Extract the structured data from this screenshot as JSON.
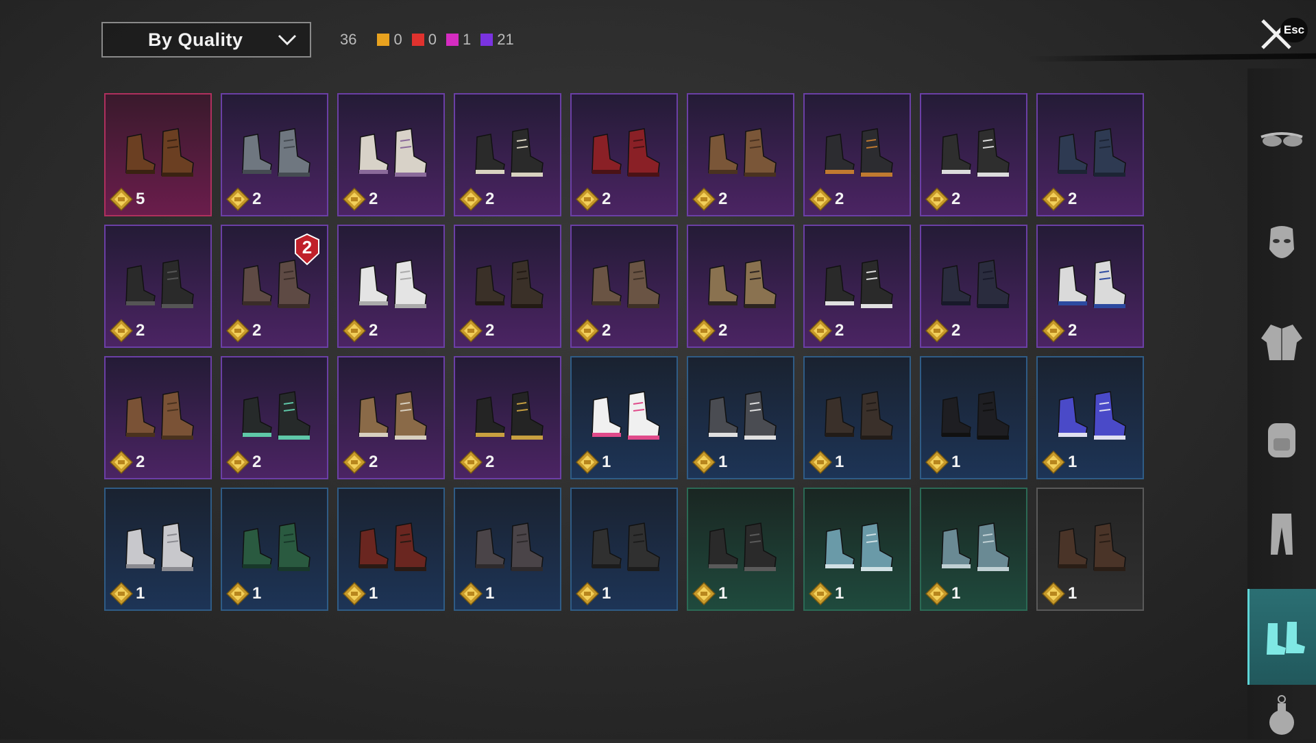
{
  "sort": {
    "label": "By Quality"
  },
  "counts": {
    "total": "36",
    "qualities": [
      {
        "color": "#e8a21f",
        "value": "0"
      },
      {
        "color": "#e0322e",
        "value": "0"
      },
      {
        "color": "#d52cc1",
        "value": "1"
      },
      {
        "color": "#7a33e0",
        "value": "21"
      }
    ]
  },
  "close": {
    "label": "Esc"
  },
  "items": [
    {
      "quality": "pink",
      "price": "5",
      "icon": "poop-slippers-icon"
    },
    {
      "quality": "purple",
      "price": "2",
      "icon": "gray-boots-icon"
    },
    {
      "quality": "purple",
      "price": "2",
      "icon": "white-sneakers-icon"
    },
    {
      "quality": "purple",
      "price": "2",
      "icon": "black-hightops-icon"
    },
    {
      "quality": "purple",
      "price": "2",
      "icon": "red-boots-icon"
    },
    {
      "quality": "purple",
      "price": "2",
      "icon": "brown-tall-boots-icon"
    },
    {
      "quality": "purple",
      "price": "2",
      "icon": "orange-sole-sneakers-icon"
    },
    {
      "quality": "purple",
      "price": "2",
      "icon": "black-white-hightops-icon"
    },
    {
      "quality": "purple",
      "price": "2",
      "icon": "blue-loafers-icon"
    },
    {
      "quality": "purple",
      "price": "2",
      "icon": "black-combat-boots-icon"
    },
    {
      "quality": "purple",
      "price": "2",
      "icon": "brown-moccasins-icon",
      "badge": "2"
    },
    {
      "quality": "purple",
      "price": "2",
      "icon": "white-sandals-icon"
    },
    {
      "quality": "purple",
      "price": "2",
      "icon": "dark-brown-boots-icon"
    },
    {
      "quality": "purple",
      "price": "2",
      "icon": "brown-work-boots-icon"
    },
    {
      "quality": "purple",
      "price": "2",
      "icon": "tan-duck-boots-icon"
    },
    {
      "quality": "purple",
      "price": "2",
      "icon": "checker-sneakers-icon"
    },
    {
      "quality": "purple",
      "price": "2",
      "icon": "navy-tall-boots-icon"
    },
    {
      "quality": "purple",
      "price": "2",
      "icon": "blue-white-boots-icon"
    },
    {
      "quality": "purple",
      "price": "2",
      "icon": "brown-lace-boots-icon"
    },
    {
      "quality": "purple",
      "price": "2",
      "icon": "teal-hightops-icon"
    },
    {
      "quality": "purple",
      "price": "2",
      "icon": "tan-sneakers-icon"
    },
    {
      "quality": "purple",
      "price": "2",
      "icon": "black-gold-sneakers-icon"
    },
    {
      "quality": "blue",
      "price": "1",
      "icon": "paint-splatter-boots-icon"
    },
    {
      "quality": "blue",
      "price": "1",
      "icon": "gray-low-sneakers-icon"
    },
    {
      "quality": "blue",
      "price": "1",
      "icon": "brown-dress-shoes-icon"
    },
    {
      "quality": "blue",
      "price": "1",
      "icon": "black-tall-boots-icon"
    },
    {
      "quality": "blue",
      "price": "1",
      "icon": "blue-velcro-sneakers-icon"
    },
    {
      "quality": "blue",
      "price": "1",
      "icon": "white-slipons-icon"
    },
    {
      "quality": "blue",
      "price": "1",
      "icon": "green-velcro-shoes-icon"
    },
    {
      "quality": "blue",
      "price": "1",
      "icon": "red-martens-icon"
    },
    {
      "quality": "blue",
      "price": "1",
      "icon": "gray-oxfords-icon"
    },
    {
      "quality": "blue",
      "price": "1",
      "icon": "dark-oxfords-icon"
    },
    {
      "quality": "green",
      "price": "1",
      "icon": "buckle-combat-boots-icon"
    },
    {
      "quality": "green",
      "price": "1",
      "icon": "light-blue-hightops-icon"
    },
    {
      "quality": "green",
      "price": "1",
      "icon": "light-blue-lowtops-icon"
    },
    {
      "quality": "gray",
      "price": "1",
      "icon": "brown-chelsea-boots-icon"
    }
  ],
  "sidebar": [
    {
      "icon": "glasses-icon",
      "active": false
    },
    {
      "icon": "mask-icon",
      "active": false
    },
    {
      "icon": "jacket-icon",
      "active": false
    },
    {
      "icon": "backpack-icon",
      "active": false
    },
    {
      "icon": "pants-icon",
      "active": false
    },
    {
      "icon": "shoes-icon",
      "active": true
    },
    {
      "icon": "grenade-icon",
      "active": false
    }
  ],
  "palette": {
    "pink": {
      "base": "#6a4a3a",
      "accent": "#3a2a20"
    },
    "purple": {
      "base": "#555",
      "accent": "#222"
    }
  }
}
